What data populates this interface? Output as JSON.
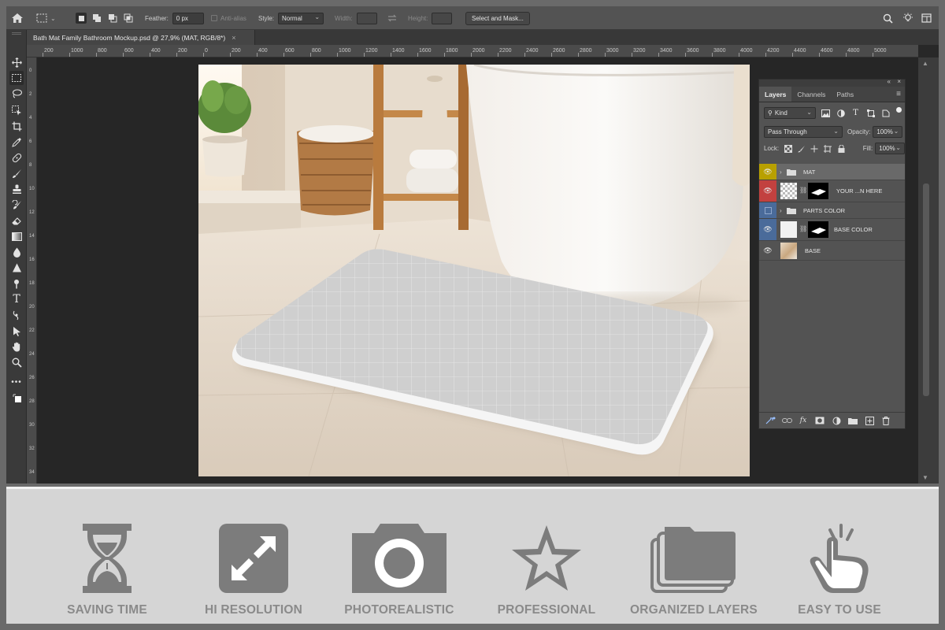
{
  "options_bar": {
    "feather_label": "Feather:",
    "feather_value": "0 px",
    "antialias_label": "Anti-alias",
    "style_label": "Style:",
    "style_value": "Normal",
    "width_label": "Width:",
    "height_label": "Height:",
    "select_mask_button": "Select and Mask..."
  },
  "document_tab": {
    "title": "Bath Mat Family Bathroom Mockup.psd @ 27,9% (MAT, RGB/8*)",
    "close": "×"
  },
  "ruler": {
    "horizontal_ticks": [
      "200",
      "1000",
      "800",
      "600",
      "400",
      "200",
      "0",
      "200",
      "400",
      "600",
      "800",
      "1000",
      "1200",
      "1400",
      "1600",
      "1800",
      "2000",
      "2200",
      "2400",
      "2600",
      "2800",
      "3000",
      "3200",
      "3400",
      "3600",
      "3800",
      "4000",
      "4200",
      "4400",
      "4600",
      "4800",
      "5000"
    ],
    "vertical_ticks": [
      "0",
      "2",
      "4",
      "6",
      "8",
      "10",
      "12",
      "14",
      "16",
      "18",
      "20",
      "22",
      "24",
      "26",
      "28",
      "30",
      "32",
      "34"
    ]
  },
  "layers_panel": {
    "tabs": [
      "Layers",
      "Channels",
      "Paths"
    ],
    "active_tab": "Layers",
    "filter_kind": "Kind",
    "blend_mode": "Pass Through",
    "opacity_label": "Opacity:",
    "opacity_value": "100%",
    "lock_label": "Lock:",
    "fill_label": "Fill:",
    "fill_value": "100%",
    "layers": [
      {
        "name": "MAT",
        "type": "group",
        "eye_color": "#b8a000",
        "selected": true
      },
      {
        "name": "YOUR ...N HERE",
        "type": "smart-object",
        "eye_color": "#c2413f",
        "selected": false
      },
      {
        "name": "PARTS COLOR",
        "type": "group",
        "eye_color": "#4a6b9a",
        "selected": false
      },
      {
        "name": "BASE COLOR",
        "type": "layer-with-mask",
        "eye_color": "#4a6b9a",
        "selected": false
      },
      {
        "name": "BASE",
        "type": "image",
        "eye_color": "",
        "selected": false
      }
    ]
  },
  "features": [
    {
      "label": "SAVING TIME",
      "icon": "hourglass-icon"
    },
    {
      "label": "HI RESOLUTION",
      "icon": "expand-arrows-icon"
    },
    {
      "label": "PHOTOREALISTIC",
      "icon": "camera-icon"
    },
    {
      "label": "PROFESSIONAL",
      "icon": "star-icon"
    },
    {
      "label": "ORGANIZED LAYERS",
      "icon": "stacked-folders-icon"
    },
    {
      "label": "EASY TO USE",
      "icon": "tap-hand-icon"
    }
  ],
  "colors": {
    "feature_icon": "#7c7c7c",
    "feature_text": "#8a8a8a",
    "strip_bg": "#d5d5d5"
  }
}
